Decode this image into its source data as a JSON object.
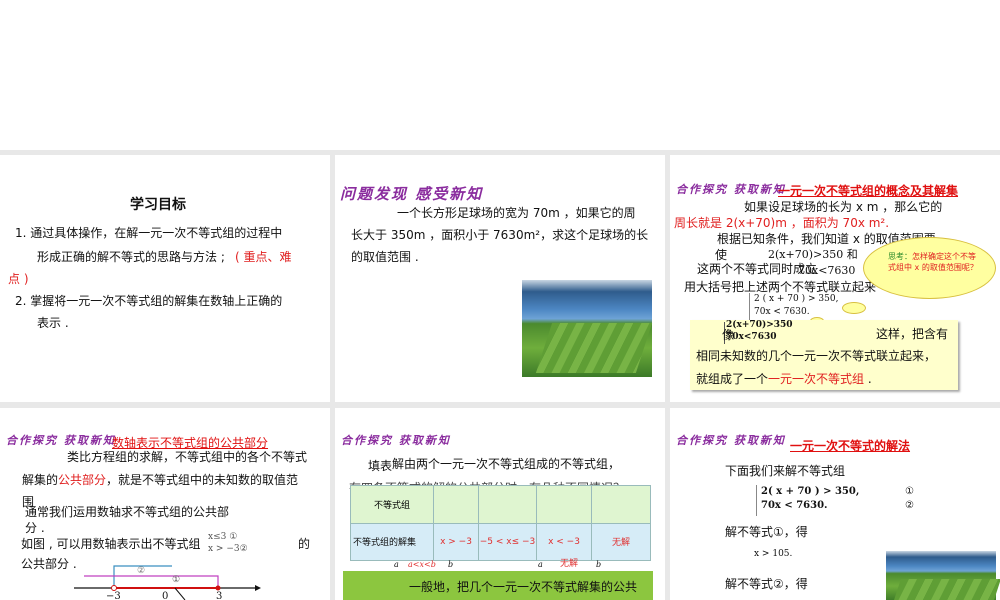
{
  "slides": [
    {
      "title": "学习目标",
      "lines": [
        "1. 通过具体操作，在解一元一次不等式组的过程中",
        "形成正确的解不等式的思路与方法 ;",
        "( 重点、难",
        "点 )",
        "2. 掌握将一元一次不等式组的解集在数轴上正确的",
        "表示 ."
      ]
    },
    {
      "header": "问题发现  感受新知",
      "lines": [
        "一个长方形足球场的宽为 70m ，如果它的周",
        "长大于 350m ，面积小于 7630m²，求这个足球场的长",
        "的取值范围 ."
      ]
    },
    {
      "header": "合作探究  获取新知",
      "title": "一元一次不等式组的概念及其解集",
      "lines": [
        "如果设足球场的长为 x m ，那么它的",
        "周长就是 2(x+70)m ，面积为 70x m².",
        "根据已知条件，我们知道 x 的取值范围要",
        "使",
        "2(x+70)>350  和",
        "这两个不等式同时成立",
        "70x<7630",
        "用大括号把上述两个不等式联立起来",
        "2 ( x + 70 ) > 350,",
        "70x < 7630."
      ],
      "cloud": {
        "label": "思考：",
        "text": "怎样确定这个不等式组中 x 的取值范围呢？"
      },
      "box": {
        "eq1": "2(x+70)>350",
        "eq2": "70x<7630",
        "prefix": "像",
        "l1": "这样，把含有",
        "l2": "相同未知数的几个一元一次不等式联立起来，",
        "l3a": "就组成了一个",
        "l3b": "一元一次不等式组",
        "l3c": " ."
      }
    },
    {
      "header": "合作探究  获取新知",
      "title": "数轴表示不等式组的公共部分",
      "lines": [
        "类比方程组的求解，不等式组中的各个不等式",
        "解集的",
        "公共部分",
        "，就是不等式组中的未知数的取值范",
        "围",
        "通常我们运用数轴求不等式组的公共部",
        "分 .",
        "如图 , 可以用数轴表示出不等式组",
        "的",
        "公共部分 ."
      ],
      "system": [
        "x≤3  ①",
        "x > −3②"
      ],
      "axis": {
        "ticks": [
          "−3",
          "0",
          "3"
        ],
        "marks": [
          "②",
          "①"
        ]
      }
    },
    {
      "header": "合作探究  获取新知",
      "lines": [
        "填表",
        "解由两个一元一次不等式组成的不等式组，",
        "有四条不等式的解的公共部分时，有几种不同情况？"
      ],
      "table": {
        "row1": [
          "不等式组",
          "",
          "",
          "",
          ""
        ],
        "row2": [
          "不等式组的解集",
          "x > −3",
          "−5 < x≤ −3",
          "x < −3",
          "无解"
        ]
      },
      "axis_labels": [
        "a",
        "a<x<b",
        "b",
        "a",
        "无解",
        "b"
      ],
      "green": "一般地，把几个一元一次不等式解集的公共"
    },
    {
      "header": "合作探究  获取新知",
      "title": "一元一次不等式的解法",
      "lines": [
        "下面我们来解不等式组",
        "2( x + 70 ) > 350,",
        "70x < 7630.",
        "①",
        "②",
        "解不等式①，得",
        "x > 105.",
        "解不等式②，得"
      ]
    }
  ]
}
